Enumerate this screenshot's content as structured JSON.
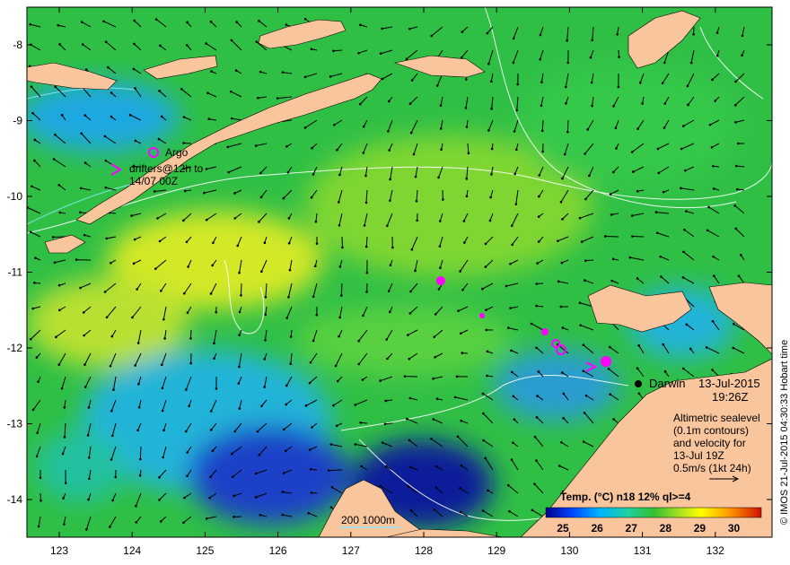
{
  "map": {
    "x_ticks": [
      "123",
      "124",
      "125",
      "126",
      "127",
      "128",
      "129",
      "130",
      "131",
      "132"
    ],
    "y_ticks": [
      "-8",
      "-9",
      "-10",
      "-11",
      "-12",
      "-13",
      "-14"
    ],
    "credit": "© IMOS 21-Jul-2015 04:30:33 Hobart time",
    "legend_argo": "Argo",
    "legend_drifters_line1": "drifters@12h to",
    "legend_drifters_line2": "14/07 00Z",
    "place_name": "Darwin",
    "date": "13-Jul-2015",
    "time": "19:26Z",
    "info_lines": [
      "Altimetric sealevel",
      "(0.1m contours)",
      "and velocity for",
      "13-Jul 19Z",
      "0.5m/s (1kt 24h)"
    ],
    "scale_label": "200  1000m",
    "colorbar_title": "Temp. (°C) n18 12% ql>=4",
    "colorbar_ticks": [
      "25",
      "26",
      "27",
      "28",
      "29",
      "30"
    ],
    "colorbar_range": [
      24.5,
      30.8
    ],
    "colors": {
      "land": "#f9c59d",
      "ocean_green": "#33c24a",
      "marker": "#ff00ff",
      "contour": "#ffffff"
    }
  }
}
